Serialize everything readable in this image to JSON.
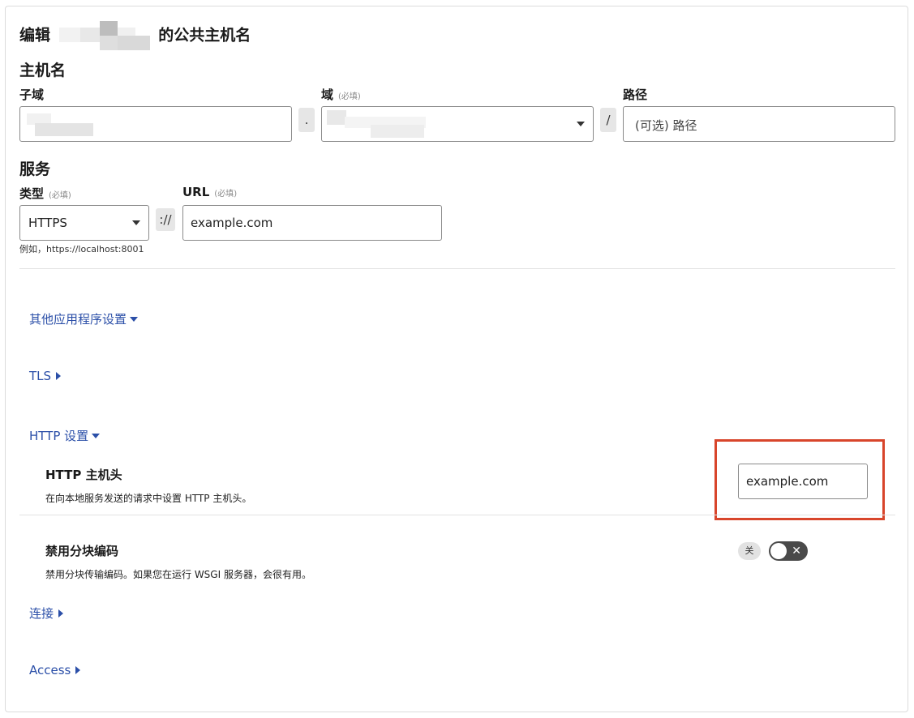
{
  "page": {
    "title_prefix": "编辑",
    "title_suffix": "的公共主机名"
  },
  "hostname": {
    "heading": "主机名",
    "subdomain_label": "子域",
    "domain_label": "域",
    "domain_required": "(必填)",
    "path_label": "路径",
    "path_placeholder": "(可选) 路径",
    "dot_sep": ".",
    "slash_sep": "/"
  },
  "service": {
    "heading": "服务",
    "type_label": "类型",
    "type_required": "(必填)",
    "type_value": "HTTPS",
    "scheme_sep": "://",
    "url_label": "URL",
    "url_required": "(必填)",
    "url_value": "example.com",
    "hint": "例如，https://localhost:8001"
  },
  "sections": {
    "other_settings": "其他应用程序设置",
    "tls": "TLS",
    "http_settings": "HTTP 设置",
    "connection": "连接",
    "access": "Access"
  },
  "http_host_header": {
    "title": "HTTP 主机头",
    "desc": "在向本地服务发送的请求中设置 HTTP 主机头。",
    "value": "example.com"
  },
  "chunked_encoding": {
    "title": "禁用分块编码",
    "desc": "禁用分块传输编码。如果您在运行 WSGI 服务器，会很有用。",
    "toggle_state_label": "关",
    "toggle_off_glyph": "✕",
    "enabled": false
  },
  "colors": {
    "link": "#2b4fa8",
    "highlight": "#d8452b",
    "toggle_off": "#4a4a4a"
  }
}
